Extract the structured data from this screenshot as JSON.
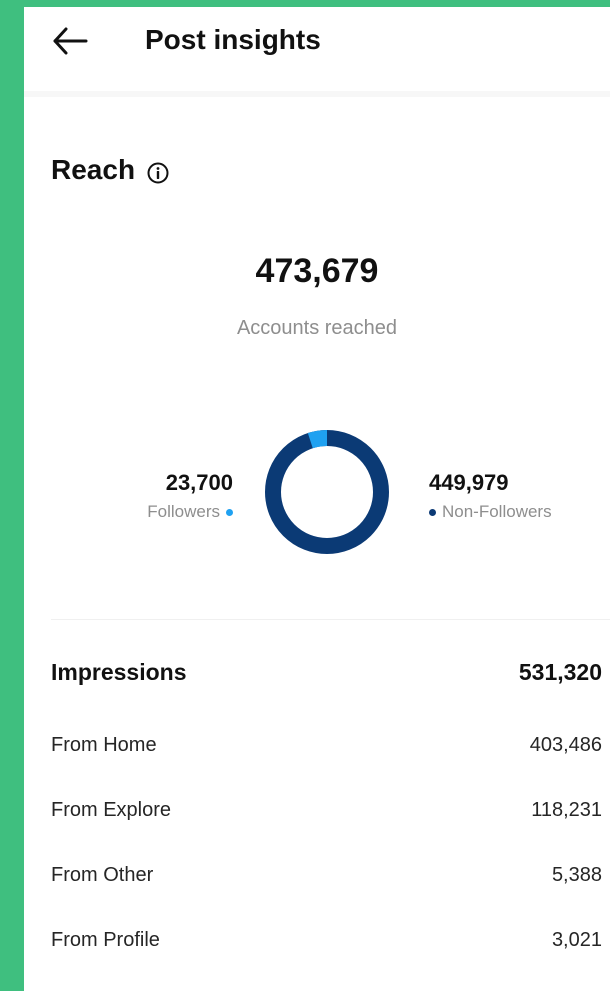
{
  "header": {
    "title": "Post insights",
    "back_icon": "back-arrow-icon"
  },
  "reach": {
    "section_title": "Reach",
    "info_icon": "info-circle-icon",
    "accounts_reached_value": "473,679",
    "accounts_reached_label": "Accounts reached",
    "followers_value": "23,700",
    "followers_label": "Followers",
    "non_followers_value": "449,979",
    "non_followers_label": "Non-Followers",
    "colors": {
      "followers": "#1fa1f1",
      "non_followers": "#0b3a75"
    },
    "donut": {
      "followers": 23700,
      "non_followers": 449979
    }
  },
  "impressions": {
    "label": "Impressions",
    "value": "531,320",
    "rows": [
      {
        "label": "From Home",
        "value": "403,486"
      },
      {
        "label": "From Explore",
        "value": "118,231"
      },
      {
        "label": "From Other",
        "value": "5,388"
      },
      {
        "label": "From Profile",
        "value": "3,021"
      }
    ]
  }
}
